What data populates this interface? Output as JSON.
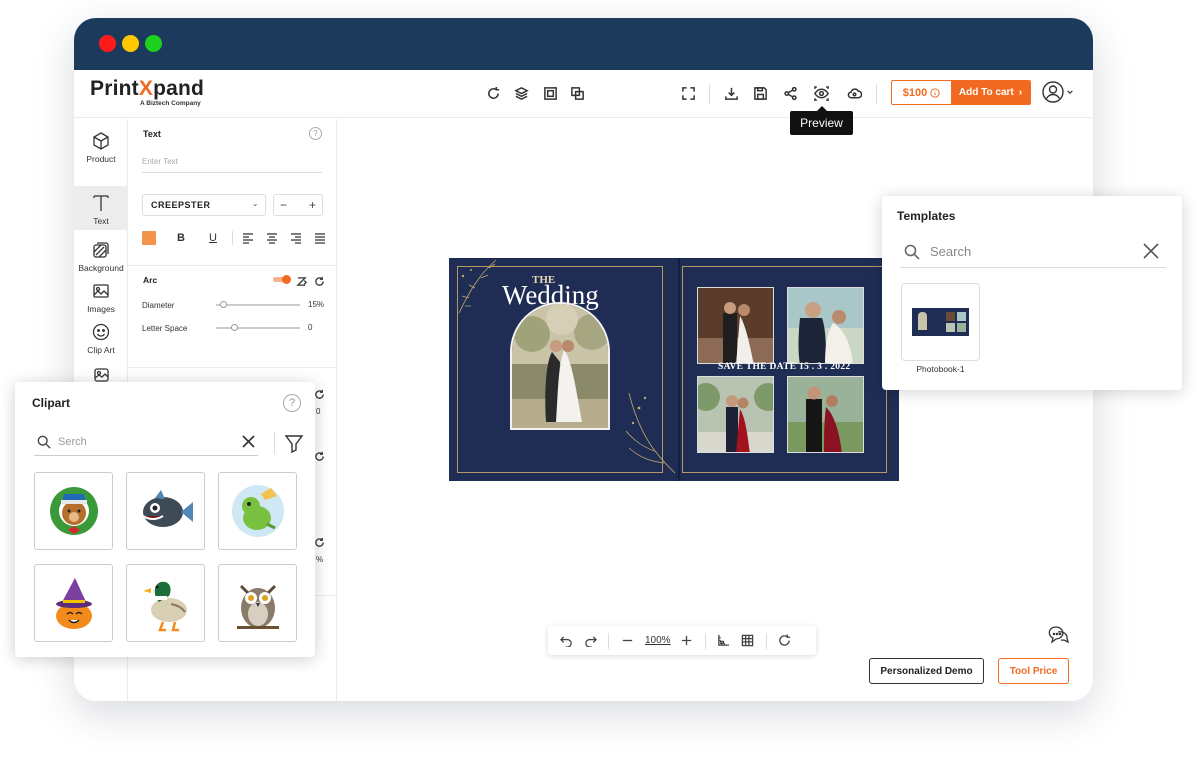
{
  "app": {
    "logo_main": "Print",
    "logo_x": "X",
    "logo_end": "pand",
    "logo_sub": "A Biztech Company"
  },
  "header": {
    "price": "$100",
    "add_to_cart": "Add To cart",
    "preview_tooltip": "Preview"
  },
  "rail": {
    "product": "Product",
    "text": "Text",
    "background": "Background",
    "images": "Images",
    "clip_art": "Clip Art"
  },
  "text_panel": {
    "title": "Text",
    "help": "?",
    "placeholder": "Enter Text",
    "font": "CREEPSTER",
    "arc_label": "Arc",
    "diameter_label": "Diameter",
    "diameter_value": "15%",
    "diameter_level": 0.05,
    "letter_space_label": "Letter Space",
    "letter_space_value": "0",
    "letter_space_level": 0.18,
    "partial_value_1": "0",
    "partial_value_2": "%",
    "accent_color": "#f4934a"
  },
  "design": {
    "the": "THE",
    "wedding": "Wedding",
    "save_the_date": "SAVE THE DATE 15 . 3 . 2022"
  },
  "zoom": {
    "value": "100%"
  },
  "buttons": {
    "personalized_demo": "Personalized Demo",
    "tool_price": "Tool Price"
  },
  "templates": {
    "title": "Templates",
    "search_placeholder": "Search",
    "items": [
      {
        "label": "Photobook-1"
      }
    ]
  },
  "clipart": {
    "title": "Clipart",
    "help": "?",
    "search_placeholder": "Serch",
    "items": [
      "bear-wreath",
      "piranha-fish",
      "dinosaur",
      "pumpkin-witch",
      "duck",
      "owl"
    ]
  },
  "colors": {
    "brand_orange": "#f26a21",
    "titlebar": "#1b3a5c",
    "design_navy": "#1f2d55",
    "gold": "#b69a63"
  }
}
